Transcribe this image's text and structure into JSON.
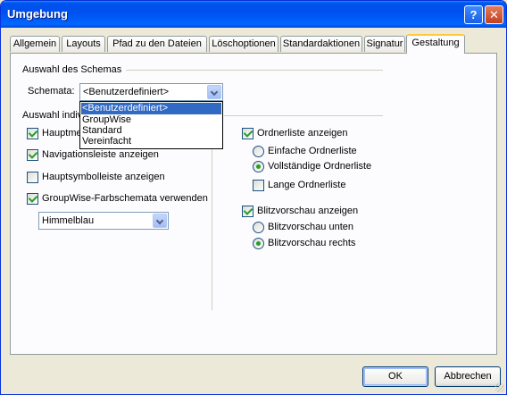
{
  "window": {
    "title": "Umgebung",
    "help_label": "?",
    "close_label": "✕"
  },
  "tabs": [
    {
      "label": "Allgemein"
    },
    {
      "label": "Layouts"
    },
    {
      "label": "Pfad zu den Dateien"
    },
    {
      "label": "Löschoptionen"
    },
    {
      "label": "Standardaktionen"
    },
    {
      "label": "Signatur"
    },
    {
      "label": "Gestaltung"
    }
  ],
  "schema_group": {
    "title": "Auswahl des Schemas",
    "label": "Schemata:",
    "selected": "<Benutzerdefiniert>",
    "options": [
      "<Benutzerdefiniert>",
      "GroupWise",
      "Standard",
      "Vereinfacht"
    ]
  },
  "individual_group": {
    "title": "Auswahl indiv",
    "main_menu": {
      "label": "Hauptme",
      "checked": true
    },
    "nav_bar": {
      "label": "Navigationsleiste anzeigen",
      "checked": true
    },
    "main_toolbar": {
      "label": "Hauptsymbolleiste anzeigen",
      "checked": false
    },
    "colors": {
      "label": "GroupWise-Farbschemata verwenden",
      "checked": true
    },
    "color_select": "Himmelblau"
  },
  "right": {
    "folder_list": {
      "label": "Ordnerliste anzeigen",
      "checked": true
    },
    "simple_list": {
      "label": "Einfache Ordnerliste",
      "selected": false
    },
    "full_list": {
      "label": "Vollständige Ordnerliste",
      "selected": true
    },
    "long_list": {
      "label": "Lange Ordnerliste",
      "checked": false
    },
    "quick_view": {
      "label": "Blitzvorschau anzeigen",
      "checked": true
    },
    "qv_bottom": {
      "label": "Blitzvorschau unten",
      "selected": false
    },
    "qv_right": {
      "label": "Blitzvorschau rechts",
      "selected": true
    }
  },
  "buttons": {
    "ok": "OK",
    "cancel": "Abbrechen"
  }
}
